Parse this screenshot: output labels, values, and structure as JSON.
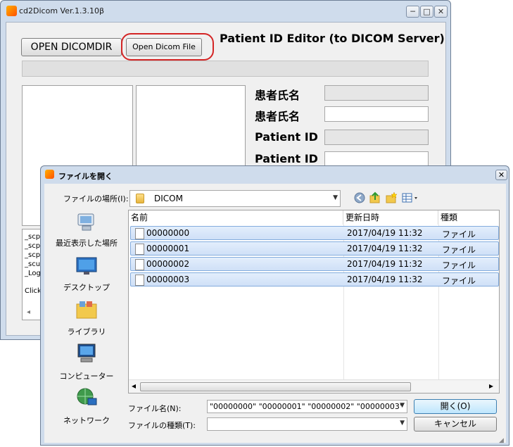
{
  "main_window": {
    "title": "cd2Dicom Ver.1.3.10β",
    "minimize": "─",
    "maximize": "□",
    "close": "✕",
    "open_dicomdir_label": "OPEN DICOMDIR",
    "open_dicom_file_label": "Open Dicom File",
    "editor_title": "Patient ID Editor  (to DICOM Server)",
    "fields": [
      {
        "label": "患者氏名",
        "value": ""
      },
      {
        "label": "患者氏名",
        "value": ""
      },
      {
        "label": "Patient ID",
        "value": ""
      },
      {
        "label": "Patient ID",
        "value": ""
      }
    ],
    "log_lines": [
      "_scp",
      "_scp",
      "_scp",
      "_scu",
      "_Log"
    ],
    "click_text": "Click",
    "scroll_left": "◂"
  },
  "dialog": {
    "title": "ファイルを開く",
    "close": "✕",
    "look_in_label": "ファイルの場所(I):",
    "look_in_value": "DICOM",
    "toolbar_icons": [
      "back-icon",
      "up-folder-icon",
      "new-folder-icon",
      "view-menu-icon"
    ],
    "places": [
      {
        "label": "最近表示した場所",
        "icon": "recent-places-icon"
      },
      {
        "label": "デスクトップ",
        "icon": "desktop-icon"
      },
      {
        "label": "ライブラリ",
        "icon": "library-icon"
      },
      {
        "label": "コンピューター",
        "icon": "computer-icon"
      },
      {
        "label": "ネットワーク",
        "icon": "network-icon"
      }
    ],
    "columns": [
      "名前",
      "更新日時",
      "種類"
    ],
    "files": [
      {
        "name": "00000000",
        "date": "2017/04/19 11:32",
        "type": "ファイル"
      },
      {
        "name": "00000001",
        "date": "2017/04/19 11:32",
        "type": "ファイル"
      },
      {
        "name": "00000002",
        "date": "2017/04/19 11:32",
        "type": "ファイル"
      },
      {
        "name": "00000003",
        "date": "2017/04/19 11:32",
        "type": "ファイル"
      }
    ],
    "filename_label": "ファイル名(N):",
    "filename_value": "\"00000000\" \"00000001\" \"00000002\" \"00000003\"",
    "filetype_label": "ファイルの種類(T):",
    "filetype_value": "",
    "open_button": "開く(O)",
    "cancel_button": "キャンセル",
    "scroll_left": "◂",
    "scroll_right": "▸"
  },
  "colors": {
    "highlight_ring": "#d42525",
    "selection": "#cfe0f7",
    "frame": "#cfdcec"
  }
}
